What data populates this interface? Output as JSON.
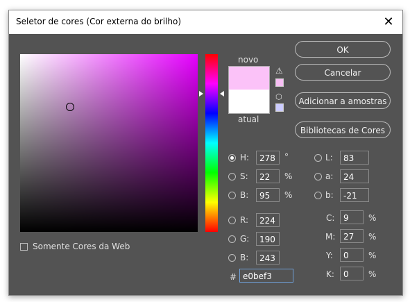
{
  "dialog": {
    "title": "Seletor de cores (Cor externa do brilho)",
    "close_glyph": "✕"
  },
  "colors": {
    "new": "#fbc2f8",
    "current": "#ffffff",
    "field_hue": "#e600ff"
  },
  "labels": {
    "new": "novo",
    "current": "atual"
  },
  "buttons": {
    "ok": "OK",
    "cancel": "Cancelar",
    "add_swatches": "Adicionar a amostras",
    "libraries": "Bibliotecas de Cores"
  },
  "checkbox": {
    "web_only": "Somente Cores da Web"
  },
  "hsb": {
    "h": {
      "label": "H:",
      "value": "278",
      "unit": "°"
    },
    "s": {
      "label": "S:",
      "value": "22",
      "unit": "%"
    },
    "b": {
      "label": "B:",
      "value": "95",
      "unit": "%"
    }
  },
  "rgb": {
    "r": {
      "label": "R:",
      "value": "224"
    },
    "g": {
      "label": "G:",
      "value": "190"
    },
    "b": {
      "label": "B:",
      "value": "243"
    }
  },
  "lab": {
    "l": {
      "label": "L:",
      "value": "83"
    },
    "a": {
      "label": "a:",
      "value": "24"
    },
    "b": {
      "label": "b:",
      "value": "-21"
    }
  },
  "cmyk": {
    "c": {
      "label": "C:",
      "value": "9",
      "unit": "%"
    },
    "m": {
      "label": "M:",
      "value": "27",
      "unit": "%"
    },
    "y": {
      "label": "Y:",
      "value": "0",
      "unit": "%"
    },
    "k": {
      "label": "K:",
      "value": "0",
      "unit": "%"
    }
  },
  "hex": {
    "label": "#",
    "value": "e0bef3"
  },
  "icons": {
    "gamut_warning": "warning-icon",
    "web_safe": "cube-icon"
  }
}
